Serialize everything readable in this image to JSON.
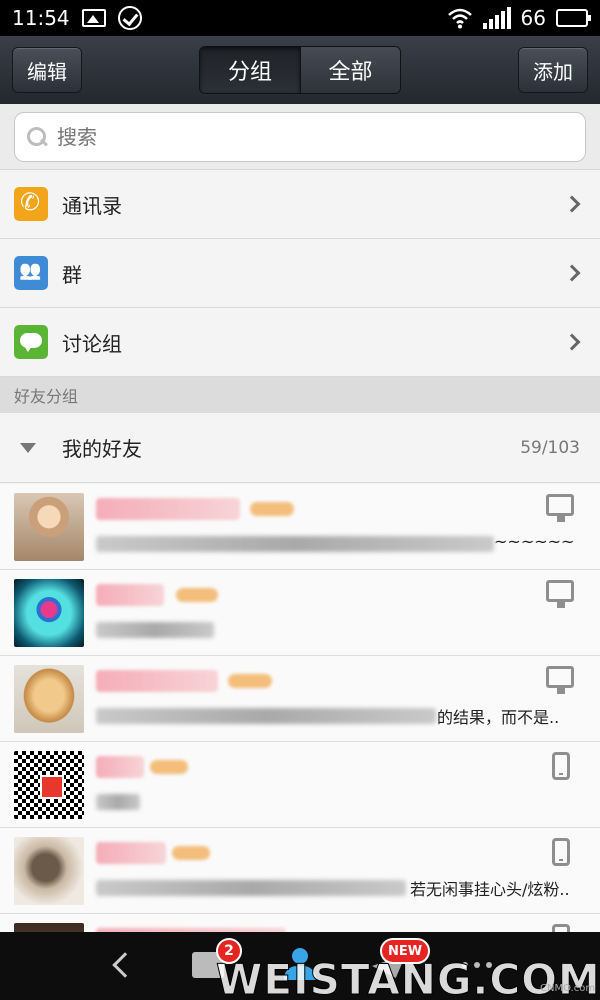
{
  "status_bar": {
    "time": "11:54",
    "battery": "66",
    "battery_level": 0.66
  },
  "header": {
    "edit_label": "编辑",
    "add_label": "添加",
    "tabs": [
      {
        "label": "分组",
        "active": true
      },
      {
        "label": "全部",
        "active": false
      }
    ]
  },
  "search": {
    "placeholder": "搜索"
  },
  "categories": [
    {
      "label": "通讯录",
      "icon": "phone-icon"
    },
    {
      "label": "群",
      "icon": "group-icon"
    },
    {
      "label": "讨论组",
      "icon": "chat-icon"
    }
  ],
  "section_header": "好友分组",
  "group": {
    "name": "我的好友",
    "count": "59/103"
  },
  "friends": [
    {
      "signature_visible": "~~~~~~",
      "device": "pc-icon"
    },
    {
      "signature_visible": "",
      "device": "pc-icon"
    },
    {
      "signature_visible": "的结果，而不是..",
      "device": "pc-icon"
    },
    {
      "signature_visible": "",
      "device": "mobile-icon"
    },
    {
      "signature_visible": "若无闲事挂心头/炫粉..",
      "device": "mobile-icon"
    },
    {
      "signature_visible": "",
      "device": "mobile-icon"
    }
  ],
  "bottom_nav": {
    "message_badge": "2",
    "new_badge": "NEW"
  },
  "watermark": {
    "main": "WEISTANG.COM",
    "small": "CNMO.com"
  },
  "colors": {
    "header_bg": "#2c3038",
    "accent_blue": "#39a4e6",
    "badge_red": "#e52521"
  }
}
